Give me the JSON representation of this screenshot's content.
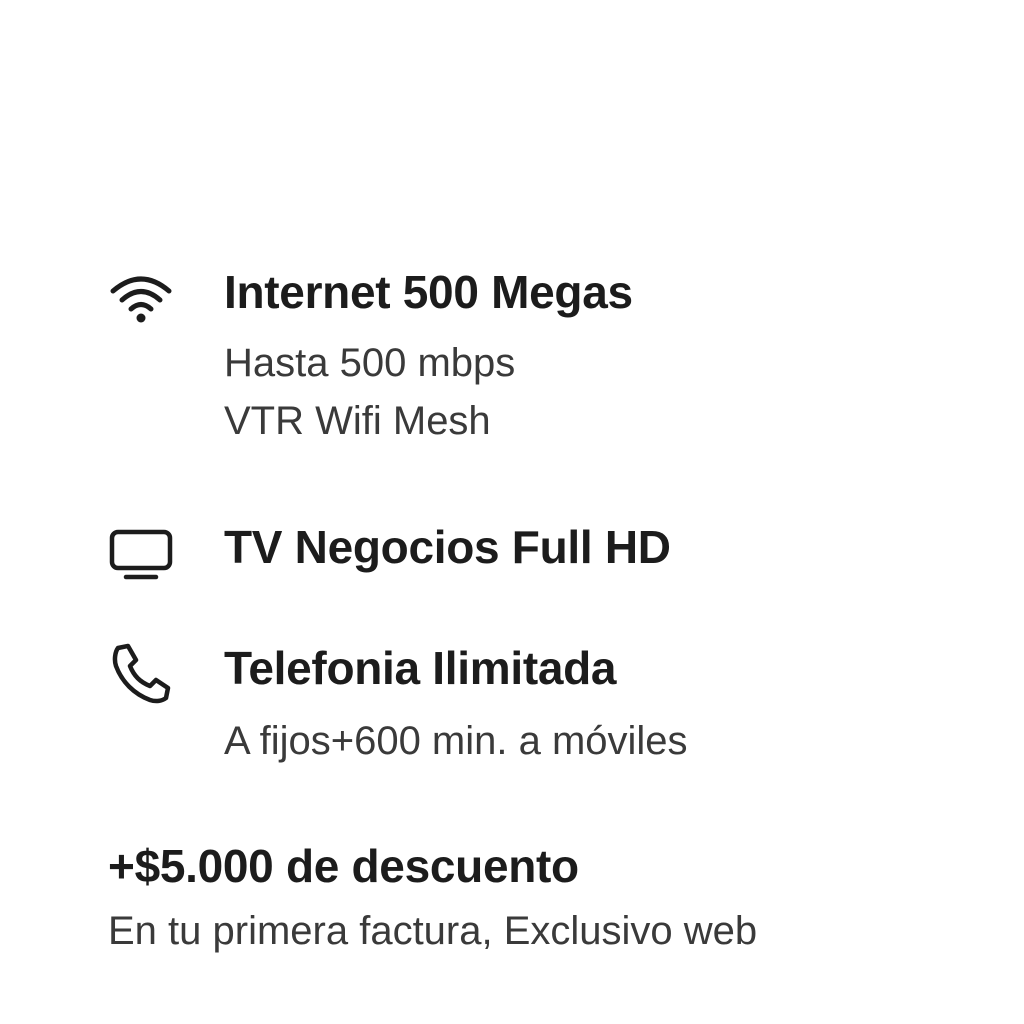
{
  "features": [
    {
      "icon": "wifi-icon",
      "title": "Internet 500 Megas",
      "lines": [
        "Hasta 500 mbps",
        "VTR Wifi Mesh"
      ]
    },
    {
      "icon": "tv-icon",
      "title": "TV Negocios Full HD",
      "lines": []
    },
    {
      "icon": "phone-icon",
      "title": "Telefonia Ilimitada",
      "lines": [
        "A fijos+600 min. a móviles"
      ]
    }
  ],
  "promo": {
    "title": "+$5.000 de descuento",
    "subtitle": "En tu primera factura, Exclusivo web"
  }
}
